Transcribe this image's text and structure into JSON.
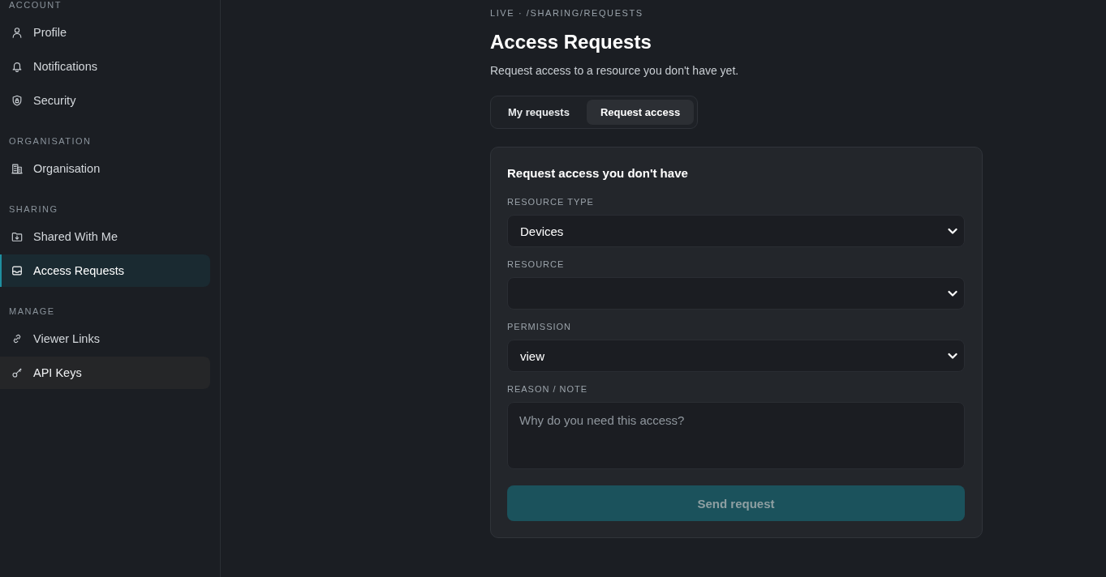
{
  "sidebar": {
    "sections": [
      {
        "title": "ACCOUNT",
        "items": [
          {
            "label": "Profile",
            "selected": false,
            "hovered": false
          },
          {
            "label": "Notifications",
            "selected": false,
            "hovered": false
          },
          {
            "label": "Security",
            "selected": false,
            "hovered": false
          }
        ]
      },
      {
        "title": "ORGANISATION",
        "items": [
          {
            "label": "Organisation",
            "selected": false,
            "hovered": false
          }
        ]
      },
      {
        "title": "SHARING",
        "items": [
          {
            "label": "Shared With Me",
            "selected": false,
            "hovered": false
          },
          {
            "label": "Access Requests",
            "selected": true,
            "hovered": false
          }
        ]
      },
      {
        "title": "MANAGE",
        "items": [
          {
            "label": "Viewer Links",
            "selected": false,
            "hovered": false
          },
          {
            "label": "API Keys",
            "selected": false,
            "hovered": true
          }
        ]
      }
    ]
  },
  "page": {
    "breadcrumb": "LIVE · /SHARING/REQUESTS",
    "title": "Access Requests",
    "subtitle": "Request access to a resource you don't have yet."
  },
  "tabs": [
    {
      "label": "My requests",
      "selected": false
    },
    {
      "label": "Request access",
      "selected": true
    }
  ],
  "form": {
    "title": "Request access you don't have",
    "fields": [
      {
        "kind": "select",
        "label": "RESOURCE TYPE",
        "value": "Devices"
      },
      {
        "kind": "select",
        "label": "RESOURCE"
      },
      {
        "kind": "select",
        "label": "PERMISSION",
        "value": "view"
      },
      {
        "kind": "textarea",
        "label": "REASON / NOTE",
        "placeholder": "Why do you need this access?"
      }
    ],
    "submit": {
      "label": "Send request",
      "disabled": true
    }
  }
}
